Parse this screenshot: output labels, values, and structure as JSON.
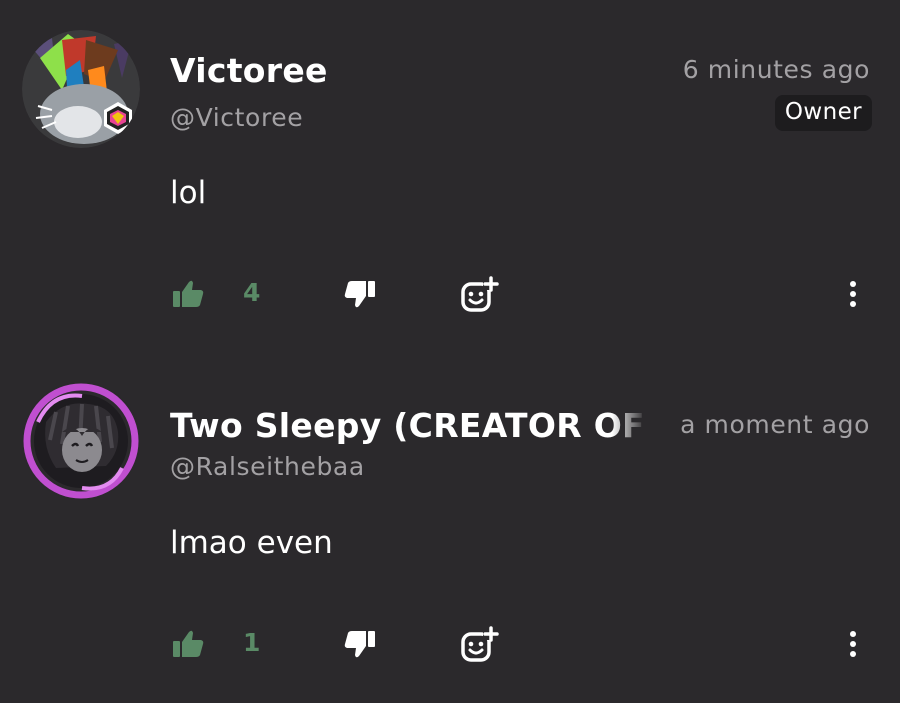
{
  "comments": [
    {
      "author": "Victoree",
      "handle": "@Victoree",
      "timestamp": "6 minutes ago",
      "badge": "Owner",
      "text": "lol",
      "likes": "4"
    },
    {
      "author": "Two Sleepy (CREATOR OF TH",
      "handle": "@Ralseithebaa",
      "timestamp": "a moment ago",
      "text": "lmao even",
      "likes": "1"
    }
  ],
  "icons": {
    "like": "thumbs-up-icon",
    "dislike": "thumbs-down-icon",
    "react": "add-reaction-icon",
    "more": "more-vertical-icon"
  },
  "colors": {
    "background": "#2b292c",
    "secondary_text": "#a3a1a4",
    "like_green": "#5a8a66",
    "badge_bg": "#1d1c1e"
  }
}
